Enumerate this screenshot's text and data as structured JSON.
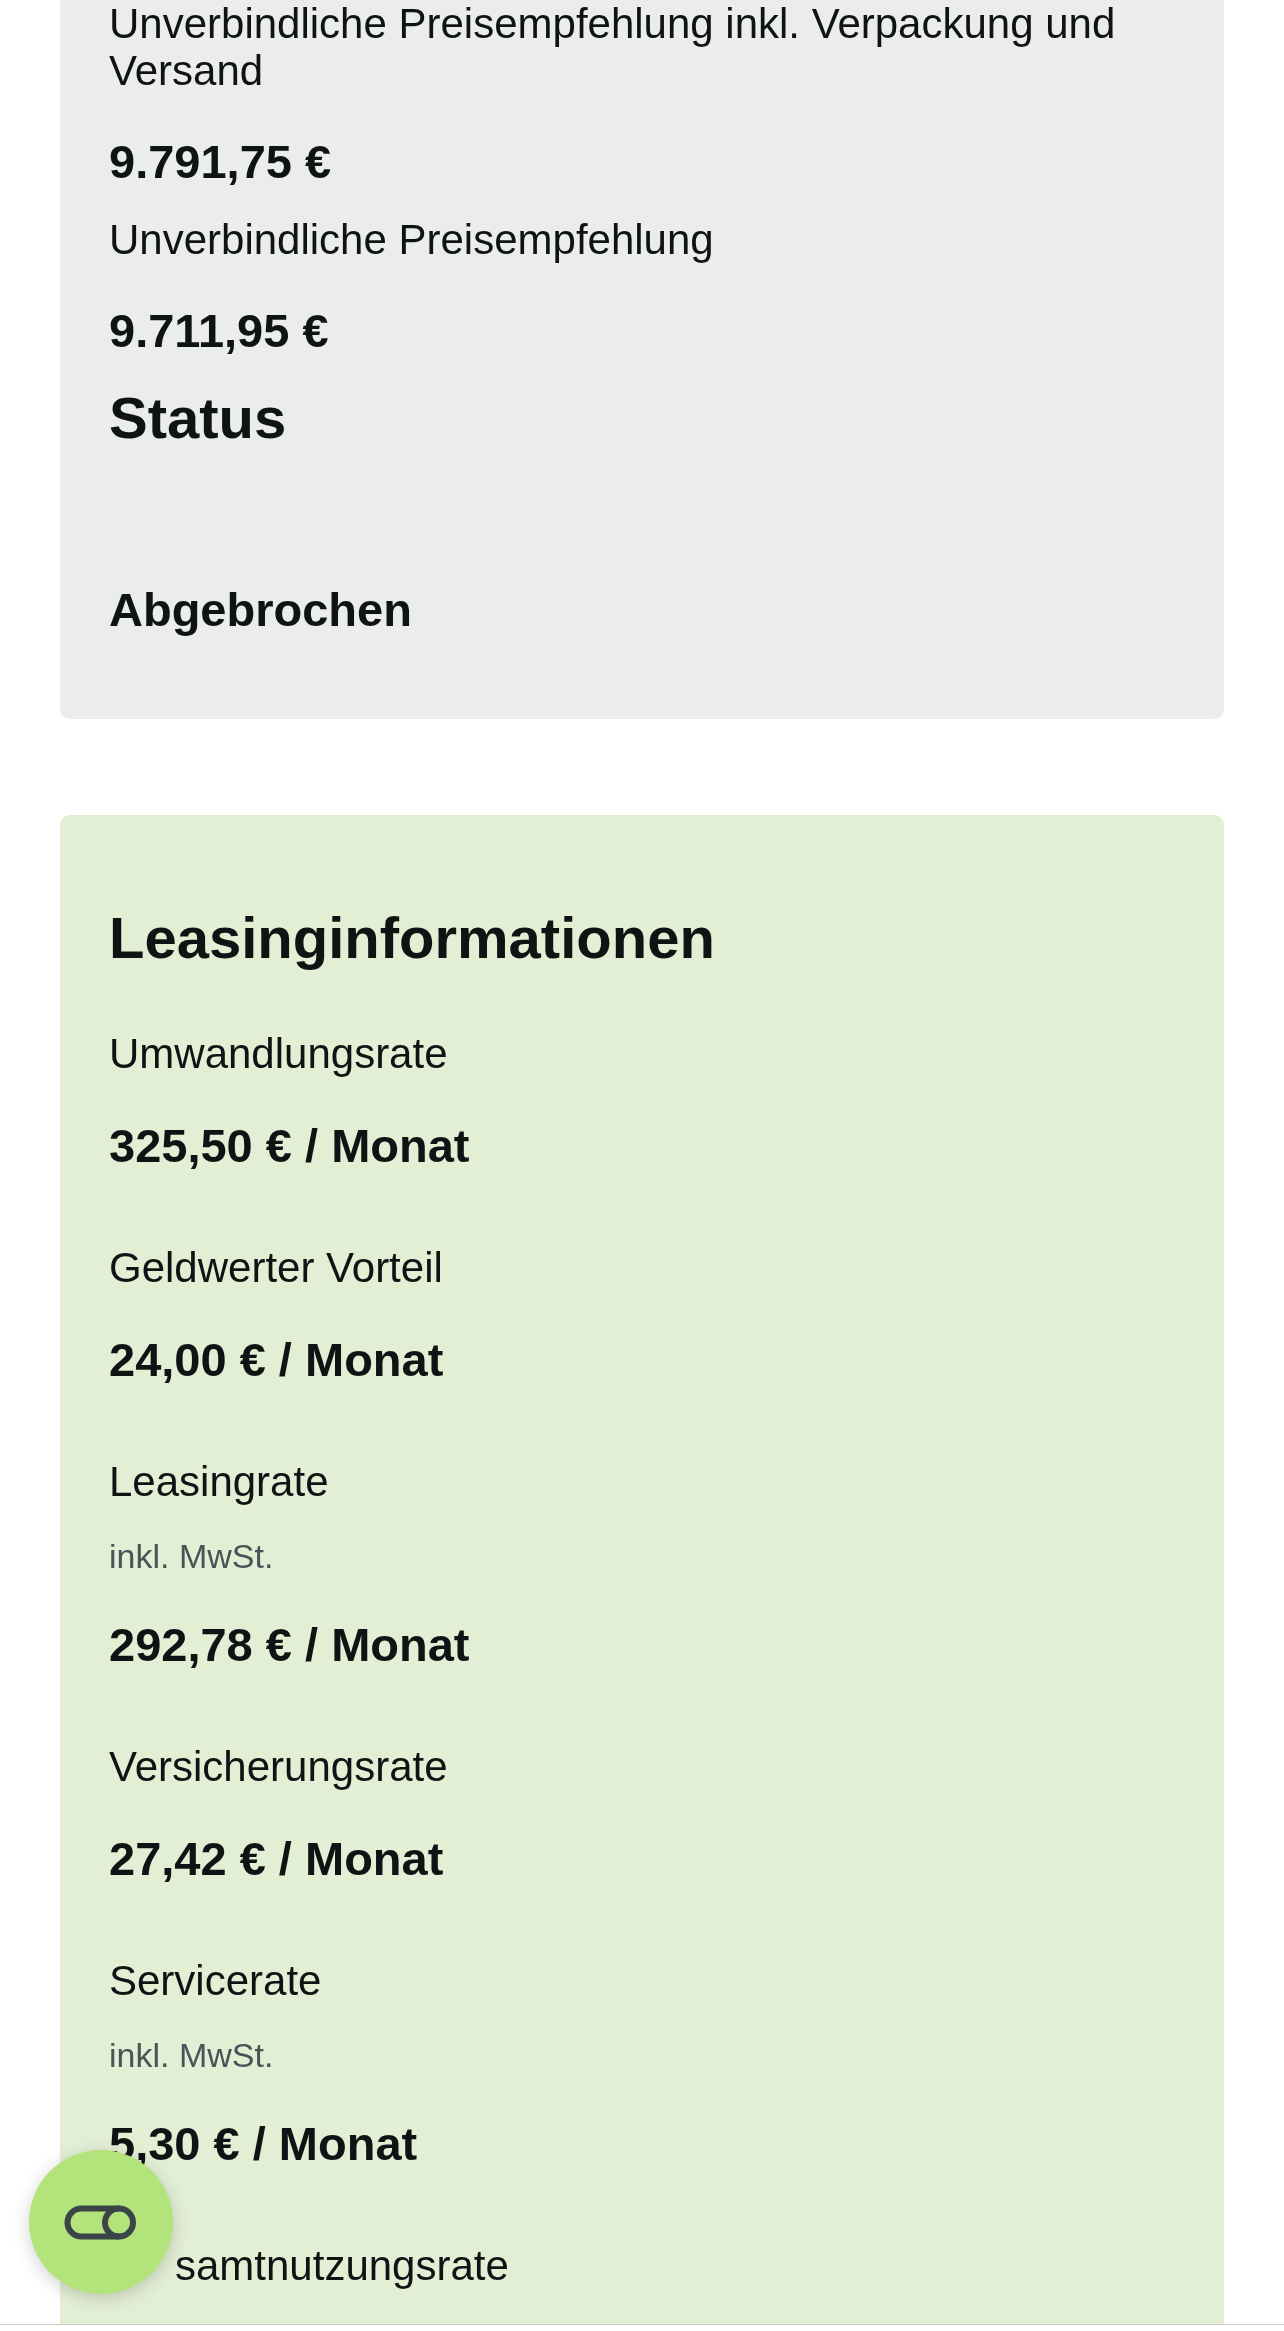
{
  "price_card": {
    "items": [
      {
        "label": "Unverbindliche Preisempfehlung inkl. Verpackung und Versand",
        "value": "9.791,75 €"
      },
      {
        "label": "Unverbindliche Preisempfehlung",
        "value": "9.711,95 €"
      }
    ],
    "status": {
      "heading": "Status",
      "value": "Abgebrochen"
    }
  },
  "leasing_card": {
    "title": "Leasinginformationen",
    "items": [
      {
        "kind": "plain",
        "label": "Umwandlungsrate",
        "value": "325,50 € / Monat"
      },
      {
        "kind": "plain",
        "label": "Geldwerter Vorteil",
        "value": "24,00 € / Monat"
      },
      {
        "kind": "plain",
        "label": "Leasingrate",
        "note": "inkl. MwSt.",
        "value": "292,78 € / Monat"
      },
      {
        "kind": "plain",
        "label": "Versicherungsrate",
        "value": "27,42 € / Monat"
      },
      {
        "kind": "plain",
        "label": "Servicerate",
        "note": "inkl. MwSt.",
        "value": "5,30 € / Monat"
      },
      {
        "kind": "partly_hidden",
        "label": "samtnutzungsrate"
      }
    ]
  }
}
